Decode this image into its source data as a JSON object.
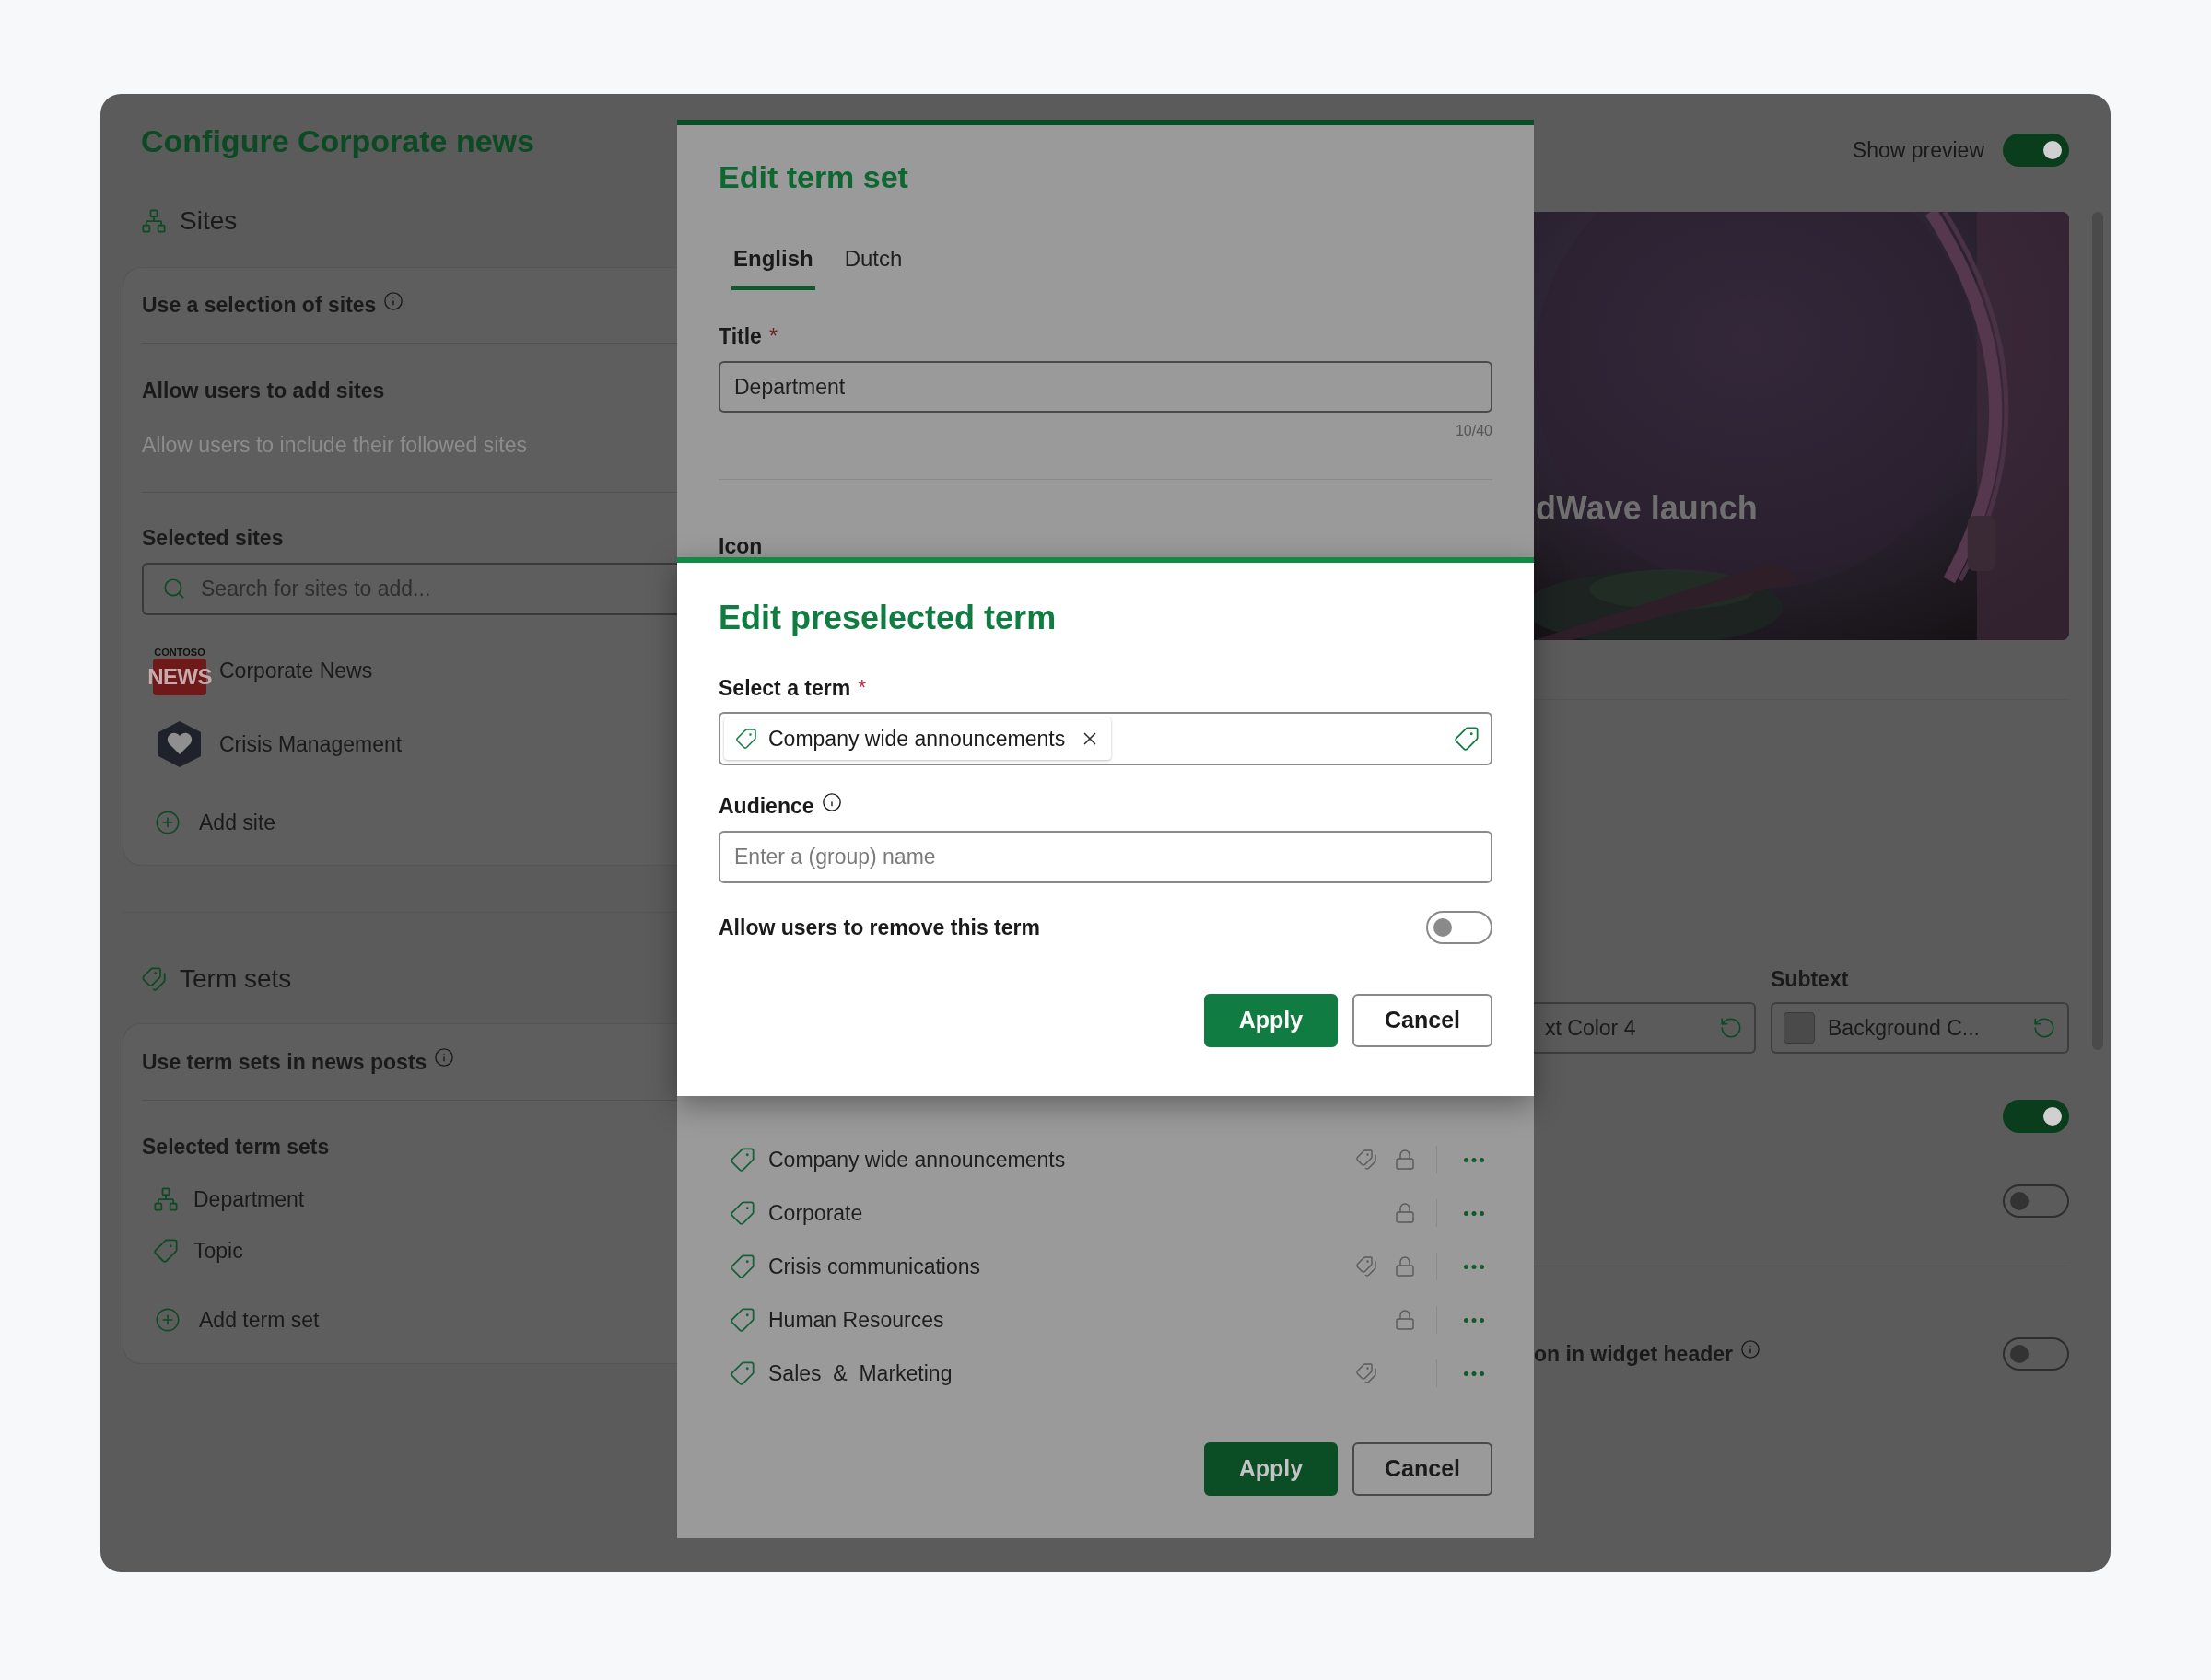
{
  "window": {
    "title": "Configure Corporate news"
  },
  "sites": {
    "heading": "Sites",
    "use_label": "Use a selection of sites",
    "allow_label": "Allow users to add sites",
    "allow_option": {
      "label": "Allow users to include their followed sites",
      "disabled": true
    },
    "selected_label": "Selected sites",
    "search": {
      "placeholder": "Search for sites to add..."
    },
    "items": [
      {
        "name": "Corporate News",
        "kind": "news",
        "logo_caption": "CONTOSO",
        "logo_text": "NEWS"
      },
      {
        "name": "Crisis Management",
        "kind": "shield"
      }
    ],
    "add": "Add site"
  },
  "term_sets": {
    "heading": "Term sets",
    "use_label": "Use term sets in news posts",
    "selected_label": "Selected term sets",
    "items": [
      {
        "name": "Department",
        "kind": "hierarchy"
      },
      {
        "name": "Topic",
        "kind": "tag"
      }
    ],
    "add": "Add term set"
  },
  "edit_term_set": {
    "title": "Edit term set",
    "tabs": [
      {
        "label": "English",
        "selected": true
      },
      {
        "label": "Dutch",
        "selected": false
      }
    ],
    "title_field": {
      "label": "Title",
      "required_mark": "*",
      "value": "Department",
      "counter": "10/40"
    },
    "icon_label": "Icon",
    "terms": [
      {
        "name": "Company wide announcements",
        "tagged": true,
        "locked": true
      },
      {
        "name": "Corporate",
        "tagged": false,
        "locked": true
      },
      {
        "name": "Crisis communications",
        "tagged": true,
        "locked": true
      },
      {
        "name": "Human Resources",
        "tagged": false,
        "locked": true
      },
      {
        "name": "Sales  &  Marketing",
        "tagged": true,
        "locked": false
      }
    ],
    "buttons": [
      {
        "label": "Apply",
        "kind": "primary"
      },
      {
        "label": "Cancel",
        "kind": "secondary"
      }
    ]
  },
  "edit_preselected_term": {
    "title": "Edit preselected term",
    "term_field": {
      "label": "Select a term",
      "required_mark": "*",
      "chips": [
        "Company wide announcements"
      ]
    },
    "audience": {
      "label": "Audience",
      "placeholder": "Enter a (group) name"
    },
    "allow_remove": {
      "label": "Allow users to remove this term",
      "on": false
    },
    "buttons": [
      {
        "label": "Apply",
        "kind": "primary"
      },
      {
        "label": "Cancel",
        "kind": "secondary"
      }
    ]
  },
  "preview": {
    "show_preview": {
      "label": "Show preview",
      "on": true
    },
    "banner_title": "dWave launch",
    "subtext_label": "Subtext",
    "color_fields": [
      {
        "value": "xt Color 4",
        "swatch": false
      },
      {
        "value": "Background C...",
        "swatch": true
      }
    ],
    "toggles": [
      {
        "on": true
      },
      {
        "on": false
      }
    ],
    "header_option": {
      "label": "on in widget header",
      "on": false
    }
  }
}
